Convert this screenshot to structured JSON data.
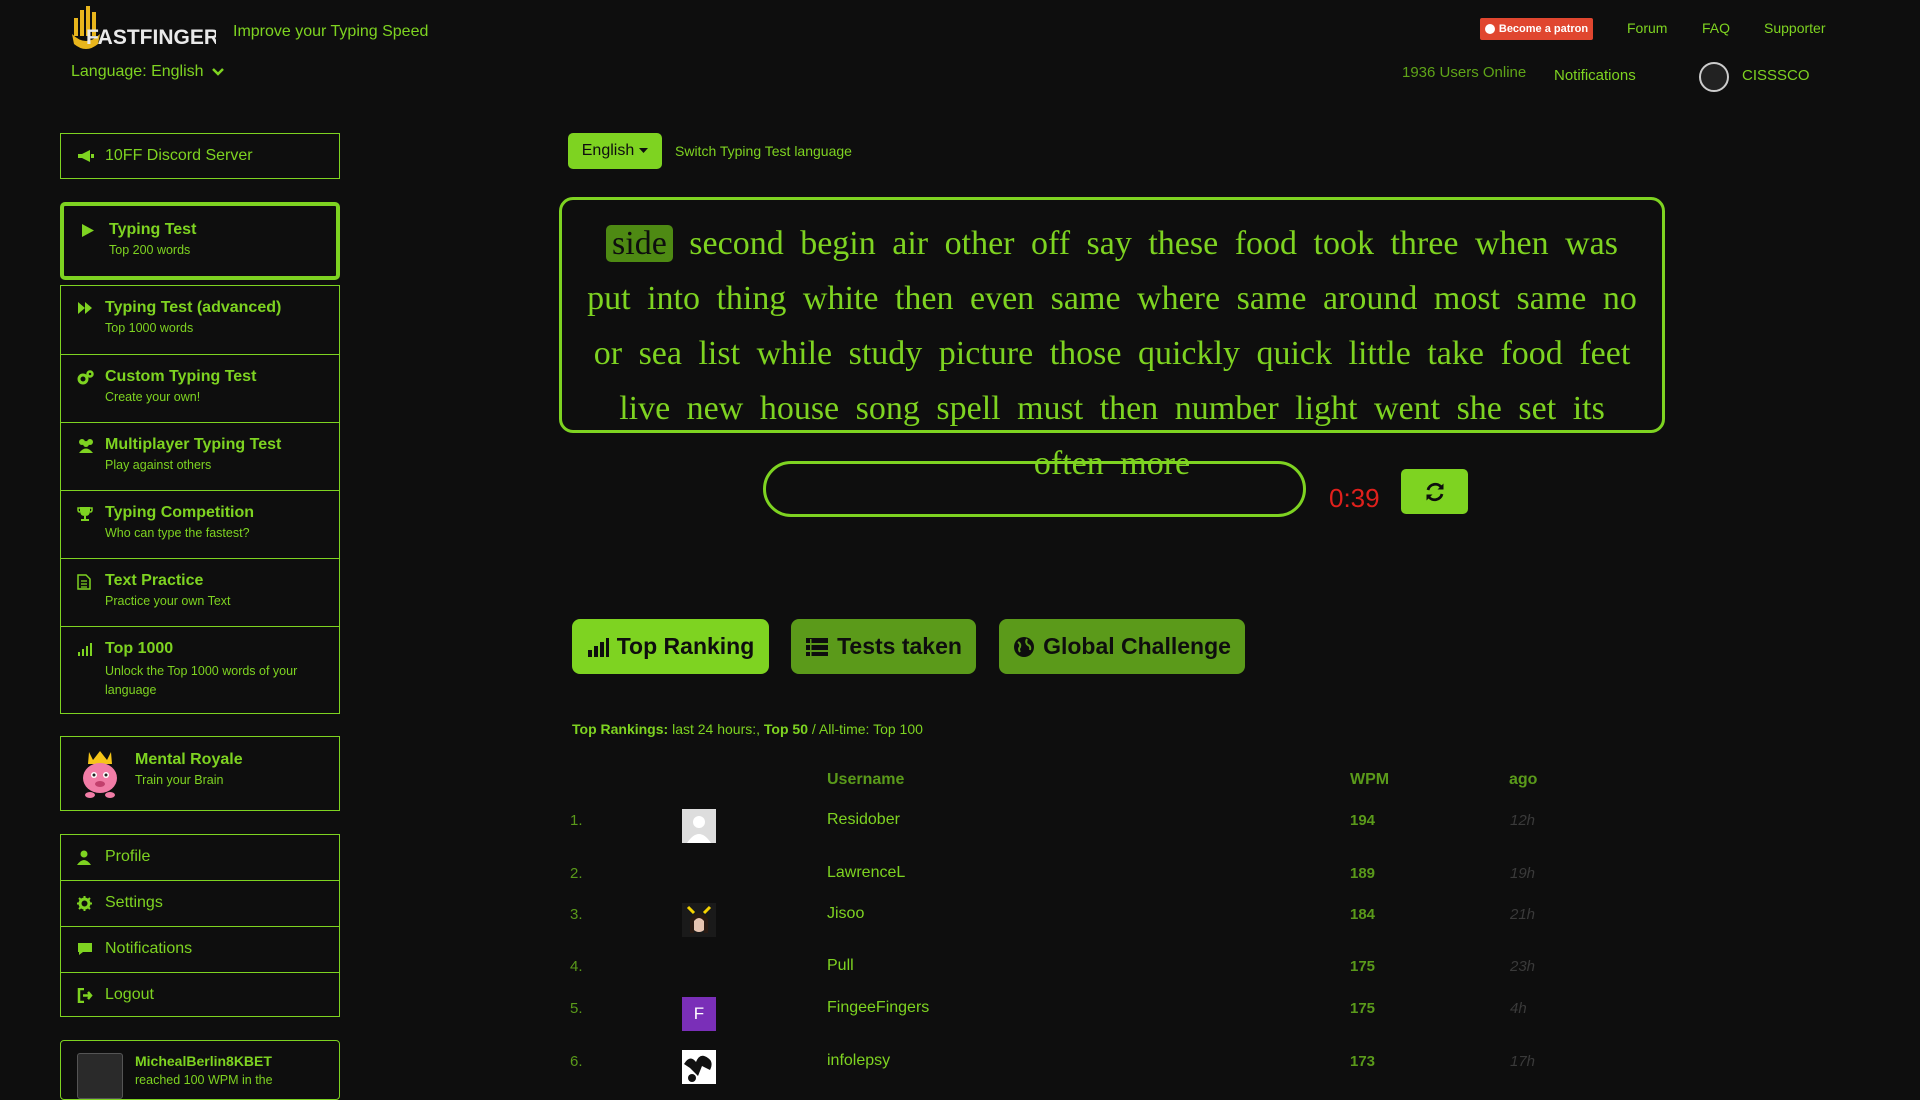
{
  "header": {
    "logo_text": "FASTFINGERS",
    "tagline": "Improve your Typing Speed",
    "language_selector": "Language: English",
    "patron_label": "Become a patron",
    "nav": [
      "Forum",
      "FAQ",
      "Supporter"
    ],
    "users_online": "1936 Users Online",
    "notifications": "Notifications",
    "username": "CISSSCO"
  },
  "sidebar": {
    "discord": "10FF Discord Server",
    "nav_items": [
      {
        "title": "Typing Test",
        "sub": "Top 200 words",
        "icon": "play-icon",
        "active": true
      },
      {
        "title": "Typing Test (advanced)",
        "sub": "Top 1000 words",
        "icon": "fast-forward-icon"
      },
      {
        "title": "Custom Typing Test",
        "sub": "Create your own!",
        "icon": "cogs-icon"
      },
      {
        "title": "Multiplayer Typing Test",
        "sub": "Play against others",
        "icon": "users-icon"
      },
      {
        "title": "Typing Competition",
        "sub": "Who can type the fastest?",
        "icon": "trophy-icon"
      },
      {
        "title": "Text Practice",
        "sub": "Practice your own Text",
        "icon": "document-icon"
      },
      {
        "title": "Top 1000",
        "sub": "Unlock the Top 1000 words of your language",
        "icon": "signal-icon"
      }
    ],
    "mental_royale": {
      "title": "Mental Royale",
      "sub": "Train your Brain"
    },
    "account_items": [
      {
        "label": "Profile",
        "icon": "user-icon"
      },
      {
        "label": "Settings",
        "icon": "gear-icon"
      },
      {
        "label": "Notifications",
        "icon": "comment-icon"
      },
      {
        "label": "Logout",
        "icon": "logout-icon"
      }
    ],
    "activity": {
      "user": "MichealBerlin8KBET",
      "text": "reached 100 WPM in the"
    }
  },
  "test": {
    "language_button": "English",
    "switch_label": "Switch Typing Test language",
    "words": [
      "side",
      "second",
      "begin",
      "air",
      "other",
      "off",
      "say",
      "these",
      "food",
      "took",
      "three",
      "when",
      "was",
      "put",
      "into",
      "thing",
      "white",
      "then",
      "even",
      "same",
      "where",
      "same",
      "around",
      "most",
      "same",
      "no",
      "or",
      "sea",
      "list",
      "while",
      "study",
      "picture",
      "those",
      "quickly",
      "quick",
      "little",
      "take",
      "food",
      "feet",
      "live",
      "new",
      "house",
      "song",
      "spell",
      "must",
      "then",
      "number",
      "light",
      "went",
      "she",
      "set",
      "its",
      "often",
      "more"
    ],
    "current_word_index": 0,
    "input_value": "",
    "timer": "0:39"
  },
  "tabs": [
    {
      "label": "Top Ranking",
      "icon": "bar-chart-icon"
    },
    {
      "label": "Tests taken",
      "icon": "list-icon"
    },
    {
      "label": "Global Challenge",
      "icon": "globe-icon"
    }
  ],
  "ranking": {
    "info_label": "Top Rankings:",
    "info_24h": " last 24 hours:, ",
    "info_top50": "Top 50",
    "info_alltime": " / All-time: Top 100",
    "headers": {
      "username": "Username",
      "wpm": "WPM",
      "ago": "ago"
    },
    "rows": [
      {
        "rank": "1.",
        "username": "Residober",
        "wpm": "194",
        "ago": "12h",
        "avatar": "default"
      },
      {
        "rank": "2.",
        "username": "LawrenceL",
        "wpm": "189",
        "ago": "19h",
        "avatar": "none"
      },
      {
        "rank": "3.",
        "username": "Jisoo",
        "wpm": "184",
        "ago": "21h",
        "avatar": "photo"
      },
      {
        "rank": "4.",
        "username": "Pull",
        "wpm": "175",
        "ago": "23h",
        "avatar": "none"
      },
      {
        "rank": "5.",
        "username": "FingeeFingers",
        "wpm": "175",
        "ago": "4h",
        "avatar": "letter",
        "avatar_letter": "F"
      },
      {
        "rank": "6.",
        "username": "infolepsy",
        "wpm": "173",
        "ago": "17h",
        "avatar": "art"
      }
    ]
  },
  "colors": {
    "accent": "#7ed321",
    "background": "#0e0e0e",
    "timer": "#e0201c",
    "patron": "#e0462f"
  }
}
